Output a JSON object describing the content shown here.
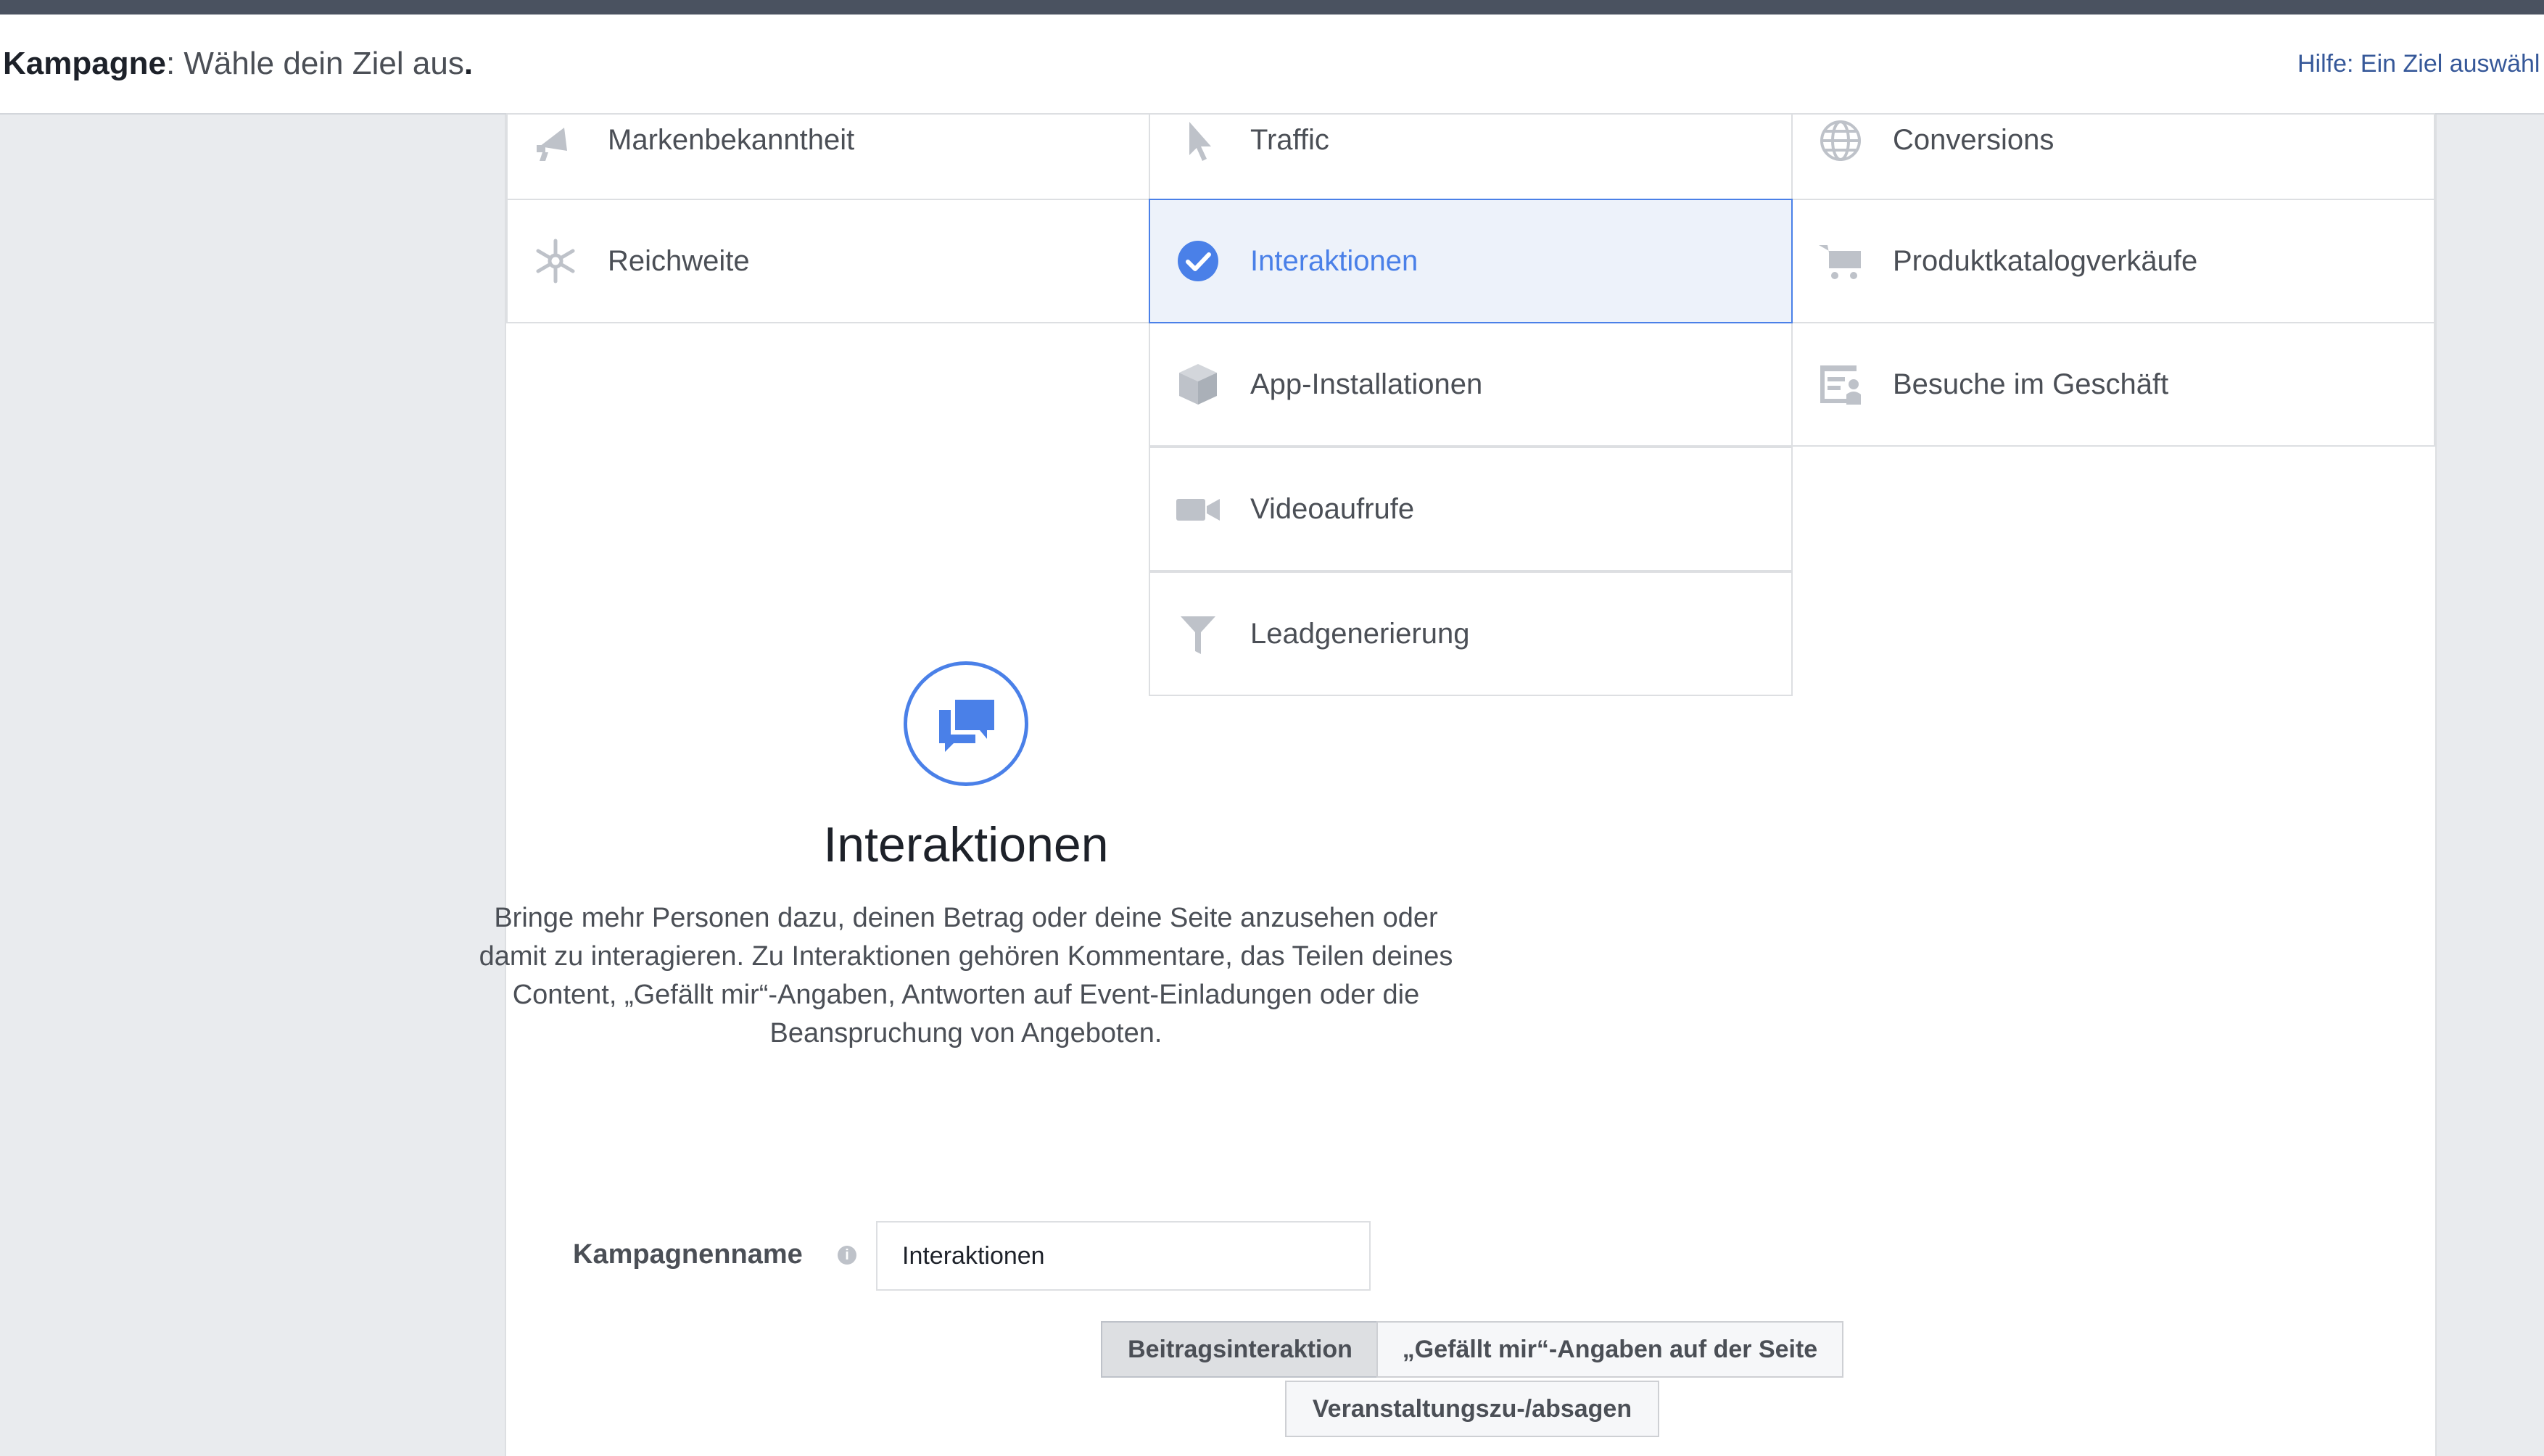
{
  "header": {
    "title_bold": "Kampagne",
    "title_rest": ": Wähle dein Ziel aus",
    "title_end": ".",
    "help": "Hilfe: Ein Ziel auswähl"
  },
  "objectives": {
    "markenbekanntheit": "Markenbekanntheit",
    "traffic": "Traffic",
    "conversions": "Conversions",
    "reichweite": "Reichweite",
    "interaktionen": "Interaktionen",
    "produktkatalog": "Produktkatalogverkäufe",
    "app_installationen": "App-Installationen",
    "besuche": "Besuche im Geschäft",
    "videoaufrufe": "Videoaufrufe",
    "leadgenerierung": "Leadgenerierung"
  },
  "selected_objective": "Interaktionen",
  "detail": {
    "title": "Interaktionen",
    "description": "Bringe mehr Personen dazu, deinen Betrag oder deine Seite anzusehen oder damit zu interagieren. Zu Interaktionen gehören Kommentare, das Teilen deines Content, „Gefällt mir“-Angaben, Antworten auf Event-Einladungen oder die Beanspruchung von Angeboten."
  },
  "campaign": {
    "label": "Kampagnenname",
    "info_glyph": "i",
    "value": "Interaktionen"
  },
  "segments": {
    "beitrag": "Beitragsinteraktion",
    "gefaellt": "„Gefällt mir“-Angaben auf der Seite",
    "veranstaltung": "Veranstaltungszu-/absagen"
  },
  "colors": {
    "accent": "#4a80e8",
    "icon_gray": "#bec2c9",
    "selected_bg": "#edf2fa"
  }
}
